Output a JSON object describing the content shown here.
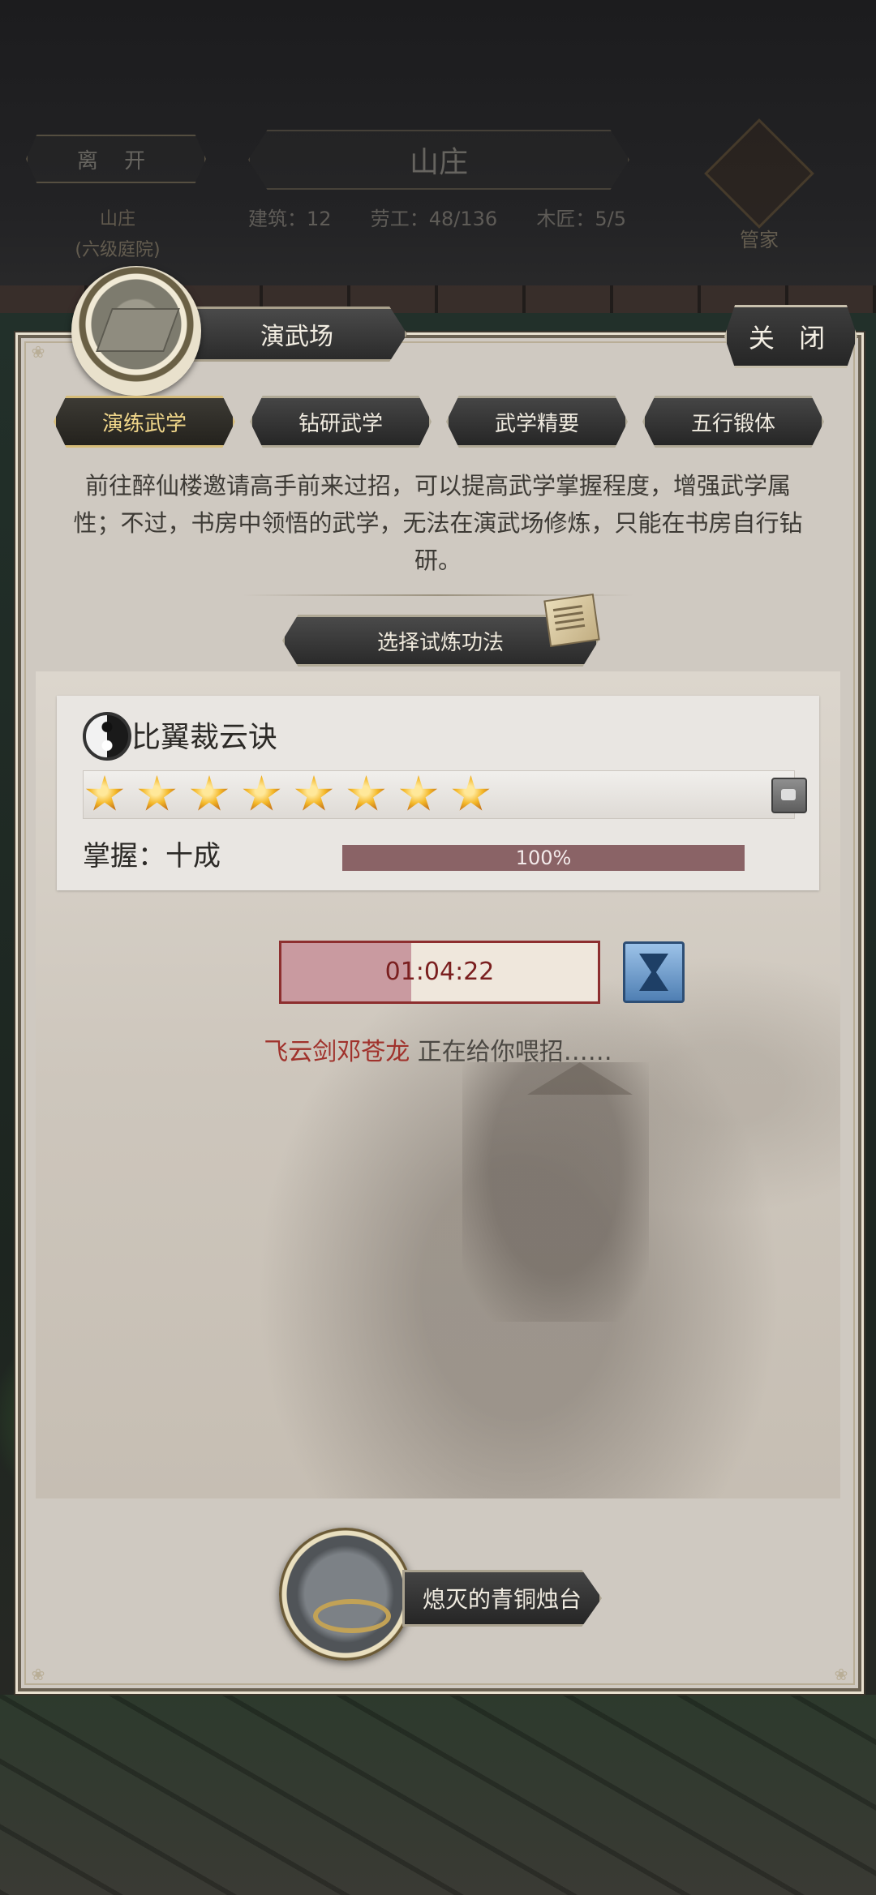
{
  "hud": {
    "leave_label": "离 开",
    "estate_name": "山庄",
    "estate_level": "(六级庭院)",
    "title": "山庄",
    "stats": [
      "建筑：12",
      "劳工：48/136",
      "木匠：5/5"
    ],
    "steward_label": "管家"
  },
  "panel": {
    "title": "演武场",
    "close_label": "关 闭",
    "tabs": [
      {
        "label": "演练武学",
        "active": true
      },
      {
        "label": "钻研武学",
        "active": false
      },
      {
        "label": "武学精要",
        "active": false
      },
      {
        "label": "五行锻体",
        "active": false
      }
    ],
    "description": "前往醉仙楼邀请高手前来过招，可以提高武学掌握程度，增强武学属性；不过，书房中领悟的武学，无法在演武场修炼，只能在书房自行钻研。",
    "select_button_label": "选择试炼功法"
  },
  "skill": {
    "name": "比翼裁云诀",
    "stars": 8,
    "mastery_label": "掌握：十成",
    "progress_percent": 100,
    "progress_text": "100%"
  },
  "timer": {
    "text": "01:04:22",
    "fill_fraction": 0.41
  },
  "sparring": {
    "partner": "飞云剑邓苍龙",
    "message": " 正在给你喂招……"
  },
  "item": {
    "label": "熄灭的青铜烛台"
  },
  "colors": {
    "accent_gold": "#f0d68a",
    "partner_red": "#a0322c",
    "progress_fill": "#8a6366"
  }
}
